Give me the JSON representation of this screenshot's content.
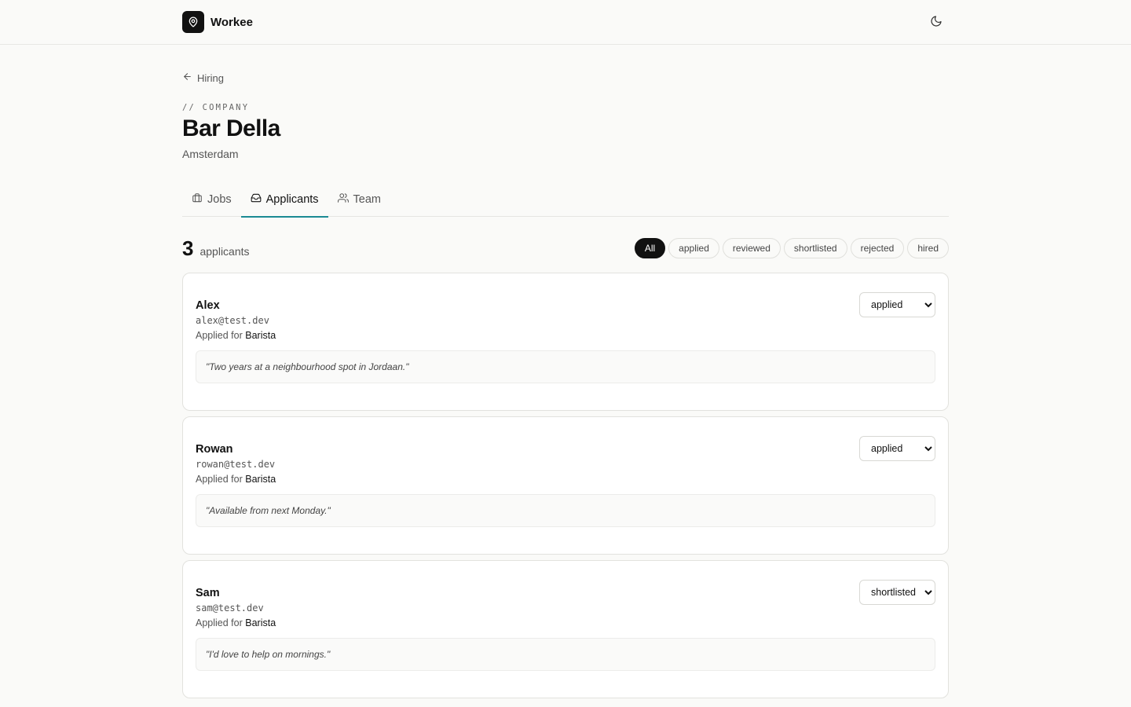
{
  "app": {
    "name": "Workee",
    "logo_icon": "map-pin-icon",
    "theme_icon": "moon-icon"
  },
  "back_link": {
    "label": "Hiring",
    "icon": "arrow-left-icon"
  },
  "company": {
    "eyebrow": "// COMPANY",
    "name": "Bar Della",
    "location": "Amsterdam"
  },
  "tabs": [
    {
      "label": "Jobs",
      "icon": "briefcase-icon",
      "active": false
    },
    {
      "label": "Applicants",
      "icon": "inbox-icon",
      "active": true
    },
    {
      "label": "Team",
      "icon": "users-icon",
      "active": false
    }
  ],
  "summary": {
    "count": "3",
    "label": "applicants"
  },
  "filters": [
    "All",
    "applied",
    "reviewed",
    "shortlisted",
    "rejected",
    "hired"
  ],
  "active_filter": "All",
  "applied_prefix": "Applied for",
  "applicants": [
    {
      "name": "Alex",
      "email": "alex@test.dev",
      "job": "Barista",
      "status": "applied",
      "note": "\"Two years at a neighbourhood spot in Jordaan.\""
    },
    {
      "name": "Rowan",
      "email": "rowan@test.dev",
      "job": "Barista",
      "status": "applied",
      "note": "\"Available from next Monday.\""
    },
    {
      "name": "Sam",
      "email": "sam@test.dev",
      "job": "Barista",
      "status": "shortlisted",
      "note": "\"I'd love to help on mornings.\""
    }
  ],
  "colors": {
    "accent": "#1b8a93",
    "ink": "#111111",
    "background": "#fafaf8"
  }
}
